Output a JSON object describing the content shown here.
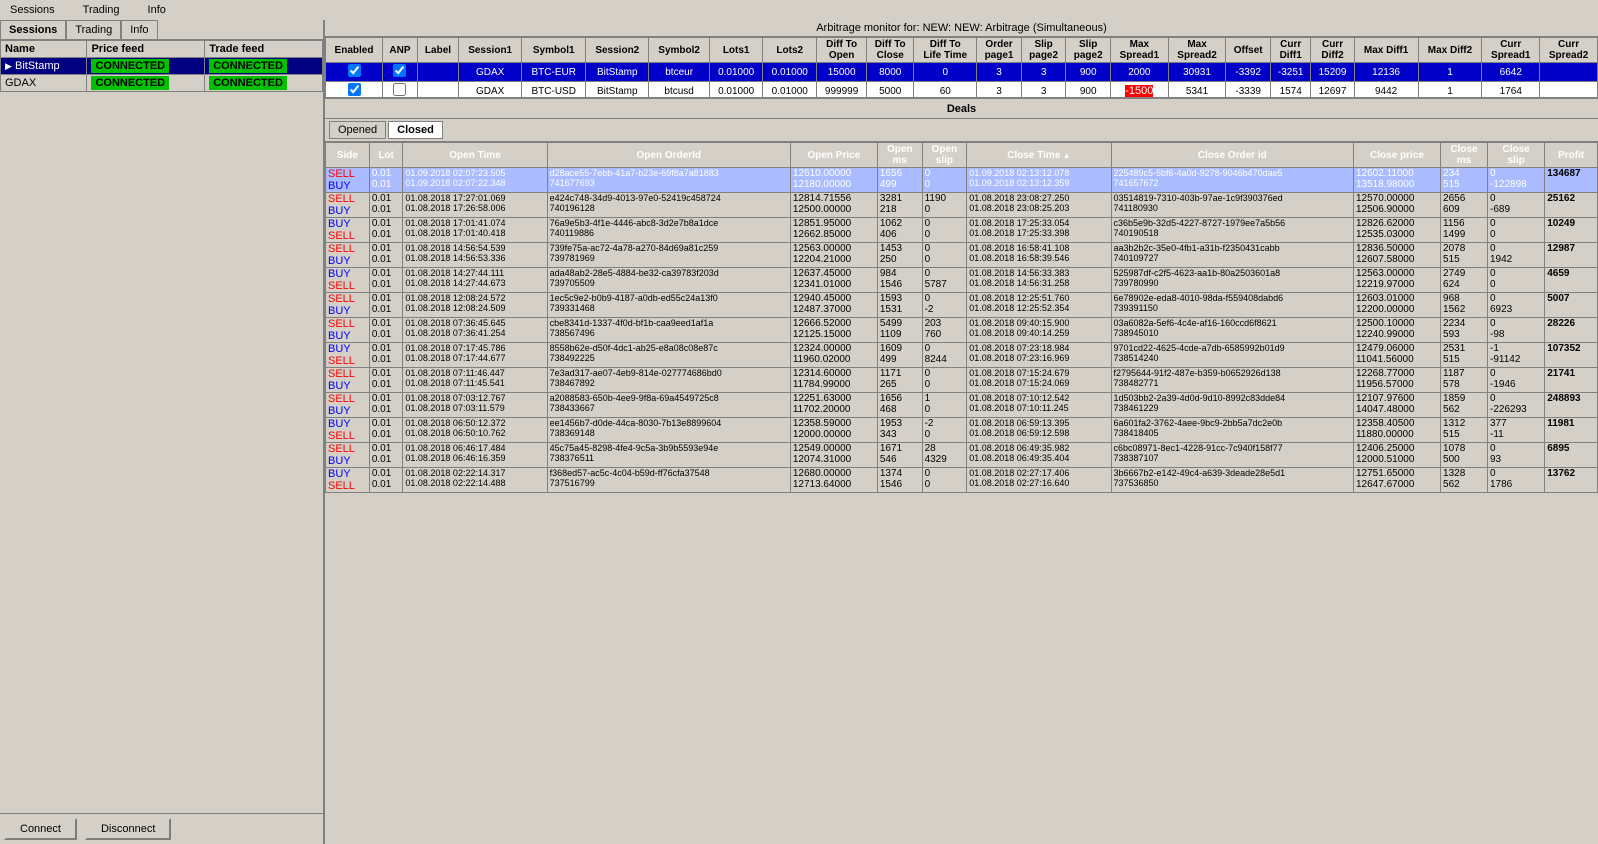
{
  "menubar": {
    "items": [
      "Sessions",
      "Trading",
      "Info"
    ]
  },
  "title": "Arbitrage monitor for: NEW: NEW: Arbitrage (Simultaneous)",
  "leftPanel": {
    "tabs": [
      "Sessions",
      "Trading",
      "Info"
    ],
    "tableHeaders": [
      "Name",
      "Price feed",
      "Trade feed"
    ],
    "rows": [
      {
        "name": "BitStamp",
        "priceFeed": "CONNECTED",
        "tradeFeed": "CONNECTED",
        "selected": true
      },
      {
        "name": "GDAX",
        "priceFeed": "CONNECTED",
        "tradeFeed": "CONNECTED",
        "selected": false
      }
    ],
    "buttons": [
      "Connect",
      "Disconnect"
    ]
  },
  "arbTable": {
    "headers": [
      "Enabled",
      "ANP",
      "Label",
      "Session1",
      "Symbol1",
      "Session2",
      "Symbol2",
      "Lots1",
      "Lots2",
      "Diff To Open",
      "Diff To Close",
      "Diff To Life Time",
      "Order page1",
      "Slip page2",
      "Slip page2_2",
      "Max Spread1",
      "Max Spread2",
      "Offset",
      "Curr Diff1",
      "Curr Diff2",
      "Max Diff1",
      "Max Diff2",
      "Curr Spread1",
      "Curr Spread2"
    ],
    "rows": [
      {
        "enabled": true,
        "anp": true,
        "label": "",
        "session1": "GDAX",
        "symbol1": "BTC-EUR",
        "session2": "BitStamp",
        "symbol2": "btceur",
        "lots1": "0.01000",
        "lots2": "0.01000",
        "diffToOpen": "15000",
        "diffToClose": "8000",
        "diffToLifeTime": "0",
        "orderPage1": "3",
        "slipPage2": "3",
        "slipPage2_2": "900",
        "maxSpread1": "2000",
        "offset": "30931",
        "currDiff1": "-3392",
        "currDiff2": "-3251",
        "maxDiff1": "15209",
        "maxDiff2": "12136",
        "currSpread1": "1",
        "currSpread2": "6642",
        "rowClass": "row-blue"
      },
      {
        "enabled": true,
        "anp": false,
        "label": "",
        "session1": "GDAX",
        "symbol1": "BTC-USD",
        "session2": "BitStamp",
        "symbol2": "btcusd",
        "lots1": "0.01000",
        "lots2": "0.01000",
        "diffToOpen": "999999",
        "diffToClose": "5000",
        "diffToLifeTime": "60",
        "orderPage1": "3",
        "slipPage2": "3",
        "slipPage2_2": "900",
        "maxSpread1": "-1500",
        "offset": "5341",
        "currDiff1": "-3339",
        "currDiff2": "1574",
        "maxDiff1": "12697",
        "maxDiff2": "9442",
        "currSpread1": "1",
        "currSpread2": "1764",
        "rowClass": "row-white",
        "maxSpread1Red": true
      }
    ]
  },
  "deals": {
    "title": "Deals",
    "tabs": [
      "Opened",
      "Closed"
    ],
    "activeTab": "Closed",
    "headers": [
      "Side",
      "Lot",
      "Open Time",
      "Open OrderId",
      "Open Price",
      "Open ms",
      "Open slip",
      "Close Time",
      "Close Order id",
      "Close price",
      "Close ms",
      "Close slip",
      "Profit"
    ],
    "rows": [
      {
        "side1": "SELL",
        "side2": "BUY",
        "lot1": "0.01",
        "lot2": "0.01",
        "openTime1": "01.09.2018 02:07:23.505",
        "openTime2": "01.09.2018 02:07:22.348",
        "openOrderId1": "d28ace55-7ebb-41a7-b23e-69f8a7a81883",
        "openOrderId2": "741677693",
        "openPrice1": "12610.00000",
        "openPrice2": "12180.00000",
        "openMs1": "1656",
        "openMs2": "499",
        "openSlip1": "0",
        "openSlip2": "0",
        "closeTime1": "01.09.2018 02:13:12.078",
        "closeTime2": "01.09.2018 02:13:12.359",
        "closeOrderId1": "225489c5-5bf6-4a0d-9278-9046b470dae5",
        "closeOrderId2": "741657672",
        "closePrice1": "12602.11000",
        "closePrice2": "13518.98000",
        "closeMs1": "234",
        "closeMs2": "515",
        "closeSlip1": "0",
        "closeSlip2": "-122898",
        "profit": "134687",
        "rowClass": "row-selected"
      },
      {
        "side1": "SELL",
        "side2": "BUY",
        "lot1": "0.01",
        "lot2": "0.01",
        "openTime1": "01.08.2018 17:27:01.069",
        "openTime2": "01.08.2018 17:26:58.006",
        "openOrderId1": "e424c748-34d9-4013-97e0-52419c458724",
        "openOrderId2": "740196128",
        "openPrice1": "12814.71556",
        "openPrice2": "12500.00000",
        "openMs1": "3281",
        "openMs2": "218",
        "openSlip1": "1190",
        "openSlip2": "0",
        "closeTime1": "01.08.2018 23:08:27.250",
        "closeTime2": "01.08.2018 23:08:25.203",
        "closeOrderId1": "03514819-7310-403b-97ae-1c9f390376ed",
        "closeOrderId2": "741180930",
        "closePrice1": "12570.00000",
        "closePrice2": "12506.90000",
        "closeMs1": "2656",
        "closeMs2": "609",
        "closeSlip1": "0",
        "closeSlip2": "-689",
        "profit": "25162"
      },
      {
        "side1": "BUY",
        "side2": "SELL",
        "lot1": "0.01",
        "lot2": "0.01",
        "openTime1": "01.08.2018 17:01:41.074",
        "openTime2": "01.08.2018 17:01:40.418",
        "openOrderId1": "76a9e5b3-4f1e-4446-abc8-3d2e7b8a1dce",
        "openOrderId2": "740119886",
        "openPrice1": "12851.95000",
        "openPrice2": "12662.85000",
        "openMs1": "1062",
        "openMs2": "406",
        "openSlip1": "0",
        "openSlip2": "0",
        "closeTime1": "01.08.2018 17:25:33.054",
        "closeTime2": "01.08.2018 17:25:33.398",
        "closeOrderId1": "c36b5e9b-32d5-4227-8727-1979ee7a5b56",
        "closeOrderId2": "740190518",
        "closePrice1": "12826.62000",
        "closePrice2": "12535.03000",
        "closeMs1": "1156",
        "closeMs2": "1499",
        "closeSlip1": "0",
        "closeSlip2": "0",
        "profit": "10249"
      },
      {
        "side1": "SELL",
        "side2": "BUY",
        "lot1": "0.01",
        "lot2": "0.01",
        "openTime1": "01.08.2018 14:56:54.539",
        "openTime2": "01.08.2018 14:56:53.336",
        "openOrderId1": "739fe75a-ac72-4a78-a270-84d69a81c259",
        "openOrderId2": "739781969",
        "openPrice1": "12563.00000",
        "openPrice2": "12204.21000",
        "openMs1": "1453",
        "openMs2": "250",
        "openSlip1": "0",
        "openSlip2": "0",
        "closeTime1": "01.08.2018 16:58:41.108",
        "closeTime2": "01.08.2018 16:58:39.546",
        "closeOrderId1": "aa3b2b2c-35e0-4fb1-a31b-f2350431cabb",
        "closeOrderId2": "740109727",
        "closePrice1": "12836.50000",
        "closePrice2": "12607.58000",
        "closeMs1": "2078",
        "closeMs2": "515",
        "closeSlip1": "0",
        "closeSlip2": "1942",
        "profit": "12987"
      },
      {
        "side1": "BUY",
        "side2": "SELL",
        "lot1": "0.01",
        "lot2": "0.01",
        "openTime1": "01.08.2018 14:27:44.111",
        "openTime2": "01.08.2018 14:27:44.673",
        "openOrderId1": "ada48ab2-28e5-4884-be32-ca39783f203d",
        "openOrderId2": "739705509",
        "openPrice1": "12637.45000",
        "openPrice2": "12341.01000",
        "openMs1": "984",
        "openMs2": "1546",
        "openSlip1": "0",
        "openSlip2": "5787",
        "closeTime1": "01.08.2018 14:56:33.383",
        "closeTime2": "01.08.2018 14:56:31.258",
        "closeOrderId1": "525987df-c2f5-4623-aa1b-80a2503601a8",
        "closeOrderId2": "739780990",
        "closePrice1": "12563.00000",
        "closePrice2": "12219.97000",
        "closeMs1": "2749",
        "closeMs2": "624",
        "closeSlip1": "0",
        "closeSlip2": "0",
        "profit": "4659"
      },
      {
        "side1": "SELL",
        "side2": "BUY",
        "lot1": "0.01",
        "lot2": "0.01",
        "openTime1": "01.08.2018 12:08:24.572",
        "openTime2": "01.08.2018 12:08:24.509",
        "openOrderId1": "1ec5c9e2-b0b9-4187-a0db-ed55c24a13f0",
        "openOrderId2": "739331468",
        "openPrice1": "12940.45000",
        "openPrice2": "12487.37000",
        "openMs1": "1593",
        "openMs2": "1531",
        "openSlip1": "0",
        "openSlip2": "-2",
        "closeTime1": "01.08.2018 12:25:51.760",
        "closeTime2": "01.08.2018 12:25:52.354",
        "closeOrderId1": "6e78902e-eda8-4010-98da-f559408dabd6",
        "closeOrderId2": "739391150",
        "closePrice1": "12603.01000",
        "closePrice2": "12200.00000",
        "closeMs1": "968",
        "closeMs2": "1562",
        "closeSlip1": "0",
        "closeSlip2": "6923",
        "profit": "5007"
      },
      {
        "side1": "SELL",
        "side2": "BUY",
        "lot1": "0.01",
        "lot2": "0.01",
        "openTime1": "01.08.2018 07:36:45.645",
        "openTime2": "01.08.2018 07:36:41.254",
        "openOrderId1": "cbe8341d-1337-4f0d-bf1b-caa9eed1af1a",
        "openOrderId2": "738567496",
        "openPrice1": "12666.52000",
        "openPrice2": "12125.15000",
        "openMs1": "5499",
        "openMs2": "1109",
        "openSlip1": "203",
        "openSlip2": "760",
        "closeTime1": "01.08.2018 09:40:15.900",
        "closeTime2": "01.08.2018 09:40:14.259",
        "closeOrderId1": "03a6082a-5ef6-4c4e-af16-160ccd6f8621",
        "closeOrderId2": "738945010",
        "closePrice1": "12500.10000",
        "closePrice2": "12240.99000",
        "closeMs1": "2234",
        "closeMs2": "593",
        "closeSlip1": "0",
        "closeSlip2": "-98",
        "profit": "28226"
      },
      {
        "side1": "BUY",
        "side2": "SELL",
        "lot1": "0.01",
        "lot2": "0.01",
        "openTime1": "01.08.2018 07:17:45.786",
        "openTime2": "01.08.2018 07:17:44.677",
        "openOrderId1": "8558b62e-d50f-4dc1-ab25-e8a08c08e87c",
        "openOrderId2": "738492225",
        "openPrice1": "12324.00000",
        "openPrice2": "11960.02000",
        "openMs1": "1609",
        "openMs2": "499",
        "openSlip1": "0",
        "openSlip2": "8244",
        "closeTime1": "01.08.2018 07:23:18.984",
        "closeTime2": "01.08.2018 07:23:16.969",
        "closeOrderId1": "9701cd22-4625-4cde-a7db-6585992b01d9",
        "closeOrderId2": "738514240",
        "closePrice1": "12479.06000",
        "closePrice2": "11041.56000",
        "closeMs1": "2531",
        "closeMs2": "515",
        "closeSlip1": "-1",
        "closeSlip2": "-91142",
        "profit": "107352"
      },
      {
        "side1": "SELL",
        "side2": "BUY",
        "lot1": "0.01",
        "lot2": "0.01",
        "openTime1": "01.08.2018 07:11:46.447",
        "openTime2": "01.08.2018 07:11:45.541",
        "openOrderId1": "7e3ad317-ae07-4eb9-814e-027774686bd0",
        "openOrderId2": "738467892",
        "openPrice1": "12314.60000",
        "openPrice2": "11784.99000",
        "openMs1": "1171",
        "openMs2": "265",
        "openSlip1": "0",
        "openSlip2": "0",
        "closeTime1": "01.08.2018 07:15:24.679",
        "closeTime2": "01.08.2018 07:15:24.069",
        "closeOrderId1": "f2795644-91f2-487e-b359-b0652926d138",
        "closeOrderId2": "738482771",
        "closePrice1": "12268.77000",
        "closePrice2": "11956.57000",
        "closeMs1": "1187",
        "closeMs2": "578",
        "closeSlip1": "0",
        "closeSlip2": "-1946",
        "profit": "21741"
      },
      {
        "side1": "SELL",
        "side2": "BUY",
        "lot1": "0.01",
        "lot2": "0.01",
        "openTime1": "01.08.2018 07:03:12.767",
        "openTime2": "01.08.2018 07:03:11.579",
        "openOrderId1": "a2088583-650b-4ee9-9f8a-69a4549725c8",
        "openOrderId2": "738433667",
        "openPrice1": "12251.63000",
        "openPrice2": "11702.20000",
        "openMs1": "1656",
        "openMs2": "468",
        "openSlip1": "1",
        "openSlip2": "0",
        "closeTime1": "01.08.2018 07:10:12.542",
        "closeTime2": "01.08.2018 07:10:11.245",
        "closeOrderId1": "1d503bb2-2a39-4d0d-9d10-8992c83dde84",
        "closeOrderId2": "738461229",
        "closePrice1": "12107.97600",
        "closePrice2": "14047.48000",
        "closeMs1": "1859",
        "closeMs2": "562",
        "closeSlip1": "0",
        "closeSlip2": "-226293",
        "profit": "248893"
      },
      {
        "side1": "BUY",
        "side2": "SELL",
        "lot1": "0.01",
        "lot2": "0.01",
        "openTime1": "01.08.2018 06:50:12.372",
        "openTime2": "01.08.2018 06:50:10.762",
        "openOrderId1": "ee1456b7-d0de-44ca-8030-7b13e8899604",
        "openOrderId2": "738369148",
        "openPrice1": "12358.59000",
        "openPrice2": "12000.00000",
        "openMs1": "1953",
        "openMs2": "343",
        "openSlip1": "-2",
        "openSlip2": "0",
        "closeTime1": "01.08.2018 06:59:13.395",
        "closeTime2": "01.08.2018 06:59:12.598",
        "closeOrderId1": "6a601fa2-3762-4aee-9bc9-2bb5a7dc2e0b",
        "closeOrderId2": "738418405",
        "closePrice1": "12358.40500",
        "closePrice2": "11880.00000",
        "closeMs1": "1312",
        "closeMs2": "515",
        "closeSlip1": "377",
        "closeSlip2": "-11",
        "profit": "11981"
      },
      {
        "side1": "SELL",
        "side2": "BUY",
        "lot1": "0.01",
        "lot2": "0.01",
        "openTime1": "01.08.2018 06:46:17.484",
        "openTime2": "01.08.2018 06:46:16.359",
        "openOrderId1": "45c75a45-8298-4fe4-9c5a-3b9b5593e94e",
        "openOrderId2": "738376511",
        "openPrice1": "12549.00000",
        "openPrice2": "12074.31000",
        "openMs1": "1671",
        "openMs2": "546",
        "openSlip1": "28",
        "openSlip2": "4329",
        "closeTime1": "01.08.2018 06:49:35.982",
        "closeTime2": "01.08.2018 06:49:35.404",
        "closeOrderId1": "c6bc08971-8ec1-4228-91cc-7c940f158f77",
        "closeOrderId2": "738387107",
        "closePrice1": "12406.25000",
        "closePrice2": "12000.51000",
        "closeMs1": "1078",
        "closeMs2": "500",
        "closeSlip1": "0",
        "closeSlip2": "93",
        "profit": "6895"
      },
      {
        "side1": "BUY",
        "side2": "SELL",
        "lot1": "0.01",
        "lot2": "0.01",
        "openTime1": "01.08.2018 02:22:14.317",
        "openTime2": "01.08.2018 02:22:14.488",
        "openOrderId1": "f368ed57-ac5c-4c04-b59d-ff76cfa37548",
        "openOrderId2": "737516799",
        "openPrice1": "12680.00000",
        "openPrice2": "12713.64000",
        "openMs1": "1374",
        "openMs2": "1546",
        "openSlip1": "0",
        "openSlip2": "0",
        "closeTime1": "01.08.2018 02:27:17.406",
        "closeTime2": "01.08.2018 02:27:16.640",
        "closeOrderId1": "3b6667b2-e142-49c4-a639-3deade28e5d1",
        "closeOrderId2": "737536850",
        "closePrice1": "12751.65000",
        "closePrice2": "12647.67000",
        "closeMs1": "1328",
        "closeMs2": "562",
        "closeSlip1": "0",
        "closeSlip2": "1786",
        "profit": "13762"
      }
    ]
  }
}
